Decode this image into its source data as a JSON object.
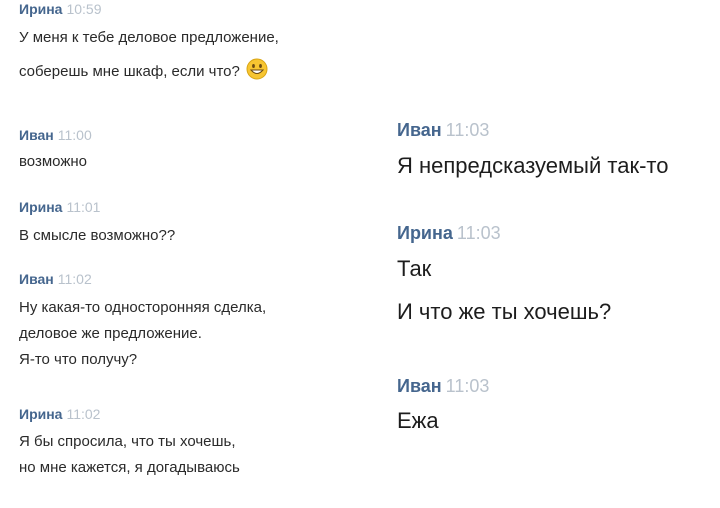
{
  "left": {
    "messages": [
      {
        "author": "Ирина",
        "time": "10:59",
        "lines": [
          "У меня к тебе деловое предложение,",
          "соберешь мне шкаф, если что?"
        ],
        "emoji": "grinning-face-icon"
      },
      {
        "author": "Иван",
        "time": "11:00",
        "lines": [
          "возможно"
        ]
      },
      {
        "author": "Ирина",
        "time": "11:01",
        "lines": [
          "В смысле возможно??"
        ]
      },
      {
        "author": "Иван",
        "time": "11:02",
        "lines": [
          "Ну какая-то односторонняя сделка,",
          "деловое же предложение.",
          "Я-то что получу?"
        ]
      },
      {
        "author": "Ирина",
        "time": "11:02",
        "lines": [
          "Я бы спросила, что ты хочешь,",
          "но мне кажется, я догадываюсь"
        ]
      }
    ]
  },
  "right": {
    "messages": [
      {
        "author": "Иван",
        "time": "11:03",
        "lines": [
          "Я непредсказуемый так-то"
        ]
      },
      {
        "author": "Ирина",
        "time": "11:03",
        "lines": [
          "Так",
          "И что же ты хочешь?"
        ]
      },
      {
        "author": "Иван",
        "time": "11:03",
        "lines": [
          "Ежа"
        ]
      }
    ]
  },
  "colors": {
    "author": "#45668e",
    "time": "#b9c2cc",
    "text": "#1f1f1f",
    "emoji_fill": "#f7c531"
  }
}
